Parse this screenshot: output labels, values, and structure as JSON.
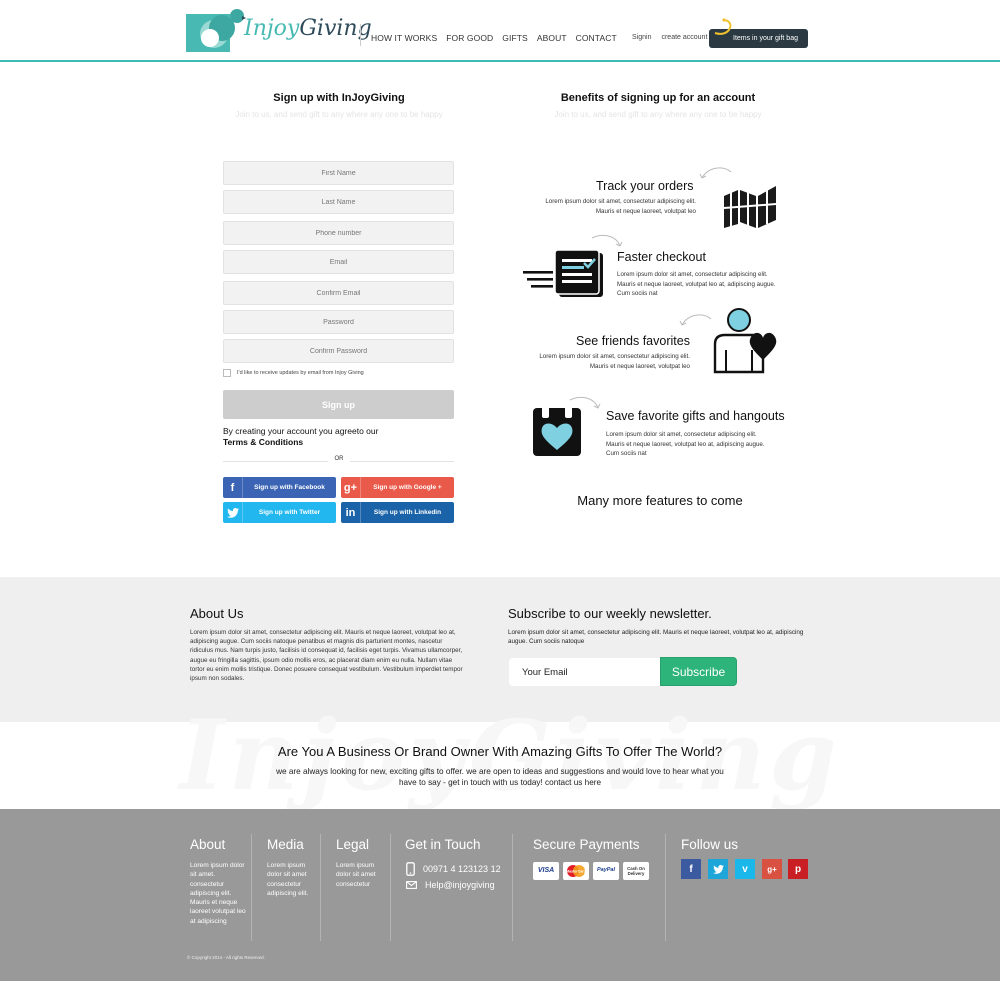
{
  "header": {
    "logo_text_a": "Injoy",
    "logo_text_b": "Giving",
    "nav": [
      "HOW IT WORKS",
      "FOR GOOD",
      "GIFTS",
      "ABOUT",
      "CONTACT"
    ],
    "signin": "Signin",
    "create_account": "create account",
    "bag_button": "Items in your gift bag"
  },
  "signup": {
    "title": "Sign up with InJoyGiving",
    "subtitle": "Join to us, and send gift to any where any one to be happy",
    "fields": {
      "first_name": "First Name",
      "last_name": "Last Name",
      "phone": "Phone number",
      "email": "Email",
      "confirm_email": "Confirm Email",
      "password": "Password",
      "confirm_password": "Confirm Password"
    },
    "checkbox_label": "I'd like to receive updates by email from Injoy Giving",
    "button": "Sign up",
    "terms_text": "By creating your account you agreeto our",
    "terms_link": "Terms & Conditions",
    "or": "OR",
    "social": {
      "facebook": "Sign up with Facebook",
      "google": "Sign up with Google +",
      "twitter": "Sign up with Twitter",
      "linkedin": "Sign up with Linkedin"
    },
    "social_icons": {
      "facebook": "f",
      "google": "g+",
      "linkedin": "in"
    }
  },
  "benefits": {
    "title": "Benefits of signing up for an account",
    "subtitle": "Join to us, and send gift to any where any one to be happy",
    "items": [
      {
        "title": "Track your orders",
        "text": "Lorem ipsum dolor sit amet, consectetur adipiscing elit. Mauris et neque laoreet, volutpat leo",
        "icon": "map-icon"
      },
      {
        "title": "Faster checkout",
        "text": "Lorem ipsum dolor sit amet, consectetur adipiscing elit. Mauris et neque laoreet, volutpat leo at, adipiscing augue. Cum sociis nat",
        "icon": "checkout-icon"
      },
      {
        "title": "See friends favorites",
        "text": "Lorem ipsum dolor sit amet, consectetur adipiscing elit. Mauris et neque laoreet, volutpat leo",
        "icon": "friend-heart-icon"
      },
      {
        "title": "Save favorite gifts and hangouts",
        "text": "Lorem ipsum dolor sit amet, consectetur adipiscing elit. Mauris et neque laoreet, volutpat leo at, adipiscing augue. Cum sociis nat",
        "icon": "gift-bag-heart-icon"
      }
    ],
    "more": "Many more features to come"
  },
  "about": {
    "title": "About Us",
    "text": "Lorem ipsum dolor sit amet, consectetur adipiscing elit. Mauris et neque laoreet, volutpat leo at, adipiscing augue. Cum sociis natoque penatibus et magnis dis parturient montes, nascetur ridiculus mus. Nam turpis justo, facilisis id consequat id, facilisis eget turpis. Vivamus ullamcorper, augue eu fringilla sagittis, ipsum odio mollis eros, ac placerat diam enim eu nulla. Nullam vitae tortor eu enim mollis tristique. Donec posuere consequat vestibulum. Vestibulum imperdiet tempor ipsum non sodales."
  },
  "newsletter": {
    "title": "Subscribe to our weekly newsletter.",
    "text": "Lorem ipsum dolor sit amet, consectetur adipiscing elit. Mauris et neque laoreet, volutpat leo at, adipiscing augue. Cum sociis natoque",
    "placeholder": "Your Email",
    "button": "Subscribe"
  },
  "business": {
    "watermark": "InjoyGiving",
    "title": "Are You A Business Or Brand Owner With Amazing Gifts To Offer The World?",
    "text": "we are always looking for new, exciting gifts to offer. we are open to ideas and suggestions and would love to hear what you have to say - get in touch with us today! contact us here"
  },
  "footer": {
    "about_title": "About",
    "about_text": "Lorem ipsum dolor sit amet. consectetur adipiscing elit. Mauris et neque laoreet volutpat leo at adipiscing",
    "media_title": "Media",
    "media_text": "Lorem ipsum dolor sit amet consectetur adipiscing elit.",
    "legal_title": "Legal",
    "legal_text": "Lorem ipsum dolor sit amet consectetur",
    "contact_title": "Get in Touch",
    "phone": "00971 4 123123 12",
    "email": "Help@injoygiving",
    "payments_title": "Secure Payments",
    "payments": [
      "VISA",
      "MasterCard",
      "PayPal",
      "Cash On Delivery"
    ],
    "follow_title": "Follow us",
    "social_letters": [
      "f",
      "t",
      "v",
      "g+",
      "p"
    ],
    "copyright": "© Copyright 2014 - All rights Reserved.",
    "colors": {
      "facebook": "#3b5aa0",
      "twitter": "#1ea6d9",
      "vimeo": "#1ab7ea",
      "google": "#d95140",
      "pinterest": "#c81e24"
    }
  },
  "colors": {
    "accent": "#3bbcb4",
    "dark": "#2b3a42",
    "subscribe": "#2cb47a",
    "footer_bg": "#999999",
    "band_bg": "#efefef"
  }
}
